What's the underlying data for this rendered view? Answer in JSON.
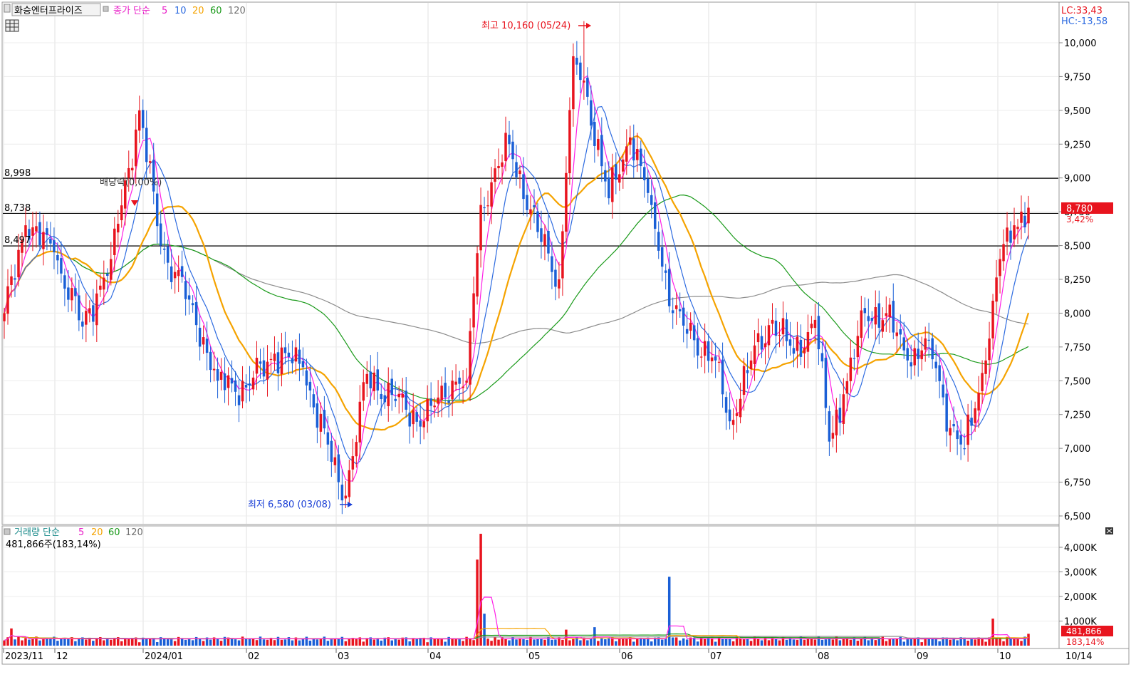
{
  "header": {
    "stock_name": "화승엔터프라이즈",
    "price_legend_title": "종가 단순",
    "ma_periods": [
      "5",
      "10",
      "20",
      "60",
      "120"
    ],
    "rsi_lc": "LC:33,43",
    "rsi_hc": "HC:-13,58"
  },
  "price_panel": {
    "hlines": [
      {
        "label": "8,998",
        "value": 8998
      },
      {
        "label": "8,738",
        "value": 8738
      },
      {
        "label": "8,497",
        "value": 8497
      }
    ],
    "dividend_note": "배당락(0,00%)",
    "high_note": "최고 10,160 (05/24)",
    "low_note": "최저 6,580 (03/08)",
    "last_price": "8,780",
    "last_change": "3,42%",
    "y_ticks": [
      "10,000",
      "9,750",
      "9,500",
      "9,250",
      "9,000",
      "8,750",
      "8,500",
      "8,250",
      "8,000",
      "7,750",
      "7,500",
      "7,250",
      "7,000",
      "6,750",
      "6,500"
    ]
  },
  "volume_panel": {
    "legend_title": "거래량 단순",
    "ma_periods": [
      "5",
      "20",
      "60",
      "120"
    ],
    "current_volume": "481,866주(183,14%)",
    "last_volume": "481,866",
    "last_vol_ratio": "183,14%",
    "y_ticks": [
      "4,000K",
      "3,000K",
      "2,000K",
      "1,000K"
    ]
  },
  "x_axis": {
    "labels": [
      "2023/11",
      "12",
      "2024/01",
      "02",
      "03",
      "04",
      "05",
      "06",
      "07",
      "08",
      "09",
      "10"
    ],
    "last_date": "10/14"
  },
  "colors": {
    "up": "#e8141e",
    "down": "#1a5fd6",
    "ma5": "#ff1ee6",
    "ma10": "#2d6be0",
    "ma20": "#f5a300",
    "ma60": "#1a9a1a",
    "ma120": "#8c8c8c"
  },
  "chart_data": {
    "type": "candlestick",
    "title": "화승엔터프라이즈",
    "y_range": [
      6500,
      10160
    ],
    "volume_range_k": [
      0,
      4500
    ],
    "months": [
      "2023/11",
      "12",
      "2024/01",
      "02",
      "03",
      "04",
      "05",
      "06",
      "07",
      "08",
      "09",
      "10"
    ],
    "close_anchors": [
      {
        "idx": 0,
        "close": 8000
      },
      {
        "idx": 6,
        "close": 8650
      },
      {
        "idx": 14,
        "close": 8450
      },
      {
        "idx": 22,
        "close": 7900
      },
      {
        "idx": 30,
        "close": 8400
      },
      {
        "idx": 38,
        "close": 9500
      },
      {
        "idx": 44,
        "close": 8500
      },
      {
        "idx": 52,
        "close": 8100
      },
      {
        "idx": 60,
        "close": 7500
      },
      {
        "idx": 68,
        "close": 7450
      },
      {
        "idx": 76,
        "close": 7700
      },
      {
        "idx": 84,
        "close": 7600
      },
      {
        "idx": 92,
        "close": 6900
      },
      {
        "idx": 96,
        "close": 6650
      },
      {
        "idx": 102,
        "close": 7550
      },
      {
        "idx": 110,
        "close": 7350
      },
      {
        "idx": 118,
        "close": 7200
      },
      {
        "idx": 126,
        "close": 7500
      },
      {
        "idx": 130,
        "close": 7500
      },
      {
        "idx": 134,
        "close": 8800
      },
      {
        "idx": 142,
        "close": 9250
      },
      {
        "idx": 150,
        "close": 8600
      },
      {
        "idx": 156,
        "close": 8250
      },
      {
        "idx": 160,
        "close": 9900
      },
      {
        "idx": 164,
        "close": 9600
      },
      {
        "idx": 170,
        "close": 8850
      },
      {
        "idx": 176,
        "close": 9300
      },
      {
        "idx": 182,
        "close": 8800
      },
      {
        "idx": 188,
        "close": 8000
      },
      {
        "idx": 194,
        "close": 7800
      },
      {
        "idx": 200,
        "close": 7650
      },
      {
        "idx": 204,
        "close": 7200
      },
      {
        "idx": 210,
        "close": 7650
      },
      {
        "idx": 216,
        "close": 7950
      },
      {
        "idx": 222,
        "close": 7700
      },
      {
        "idx": 228,
        "close": 7950
      },
      {
        "idx": 232,
        "close": 7050
      },
      {
        "idx": 236,
        "close": 7400
      },
      {
        "idx": 242,
        "close": 8000
      },
      {
        "idx": 248,
        "close": 8000
      },
      {
        "idx": 254,
        "close": 7650
      },
      {
        "idx": 260,
        "close": 7800
      },
      {
        "idx": 266,
        "close": 7150
      },
      {
        "idx": 270,
        "close": 7000
      },
      {
        "idx": 276,
        "close": 7650
      },
      {
        "idx": 280,
        "close": 8400
      },
      {
        "idx": 284,
        "close": 8650
      },
      {
        "idx": 288,
        "close": 8780
      }
    ],
    "volume_spikes": [
      {
        "idx": 2,
        "vol_k": 700
      },
      {
        "idx": 63,
        "vol_k": 330
      },
      {
        "idx": 133,
        "vol_k": 3500
      },
      {
        "idx": 134,
        "vol_k": 4550
      },
      {
        "idx": 135,
        "vol_k": 1300
      },
      {
        "idx": 158,
        "vol_k": 650
      },
      {
        "idx": 166,
        "vol_k": 750
      },
      {
        "idx": 187,
        "vol_k": 2800
      },
      {
        "idx": 278,
        "vol_k": 1100
      },
      {
        "idx": 288,
        "vol_k": 482
      }
    ]
  }
}
